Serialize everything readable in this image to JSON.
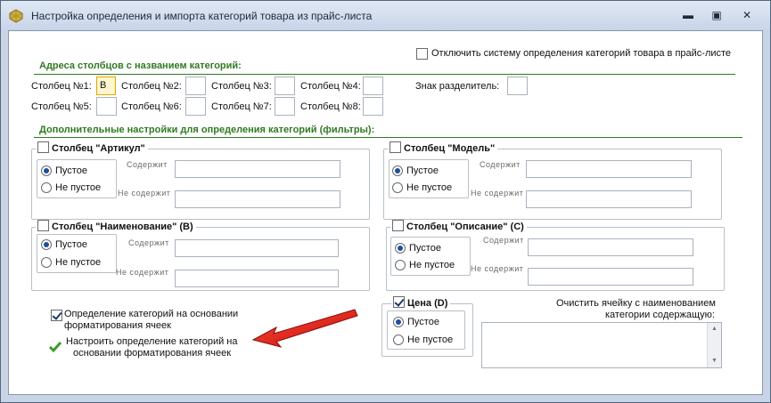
{
  "window": {
    "title": "Настройка определения и импорта категорий товара из прайс-листа",
    "minimize_glyph": "▬",
    "maximize_glyph": "▣",
    "close_glyph": "✕"
  },
  "disable_system": {
    "label": "Отключить систему определения категорий товара в прайс-листе",
    "checked": false
  },
  "columns_section": {
    "heading": "Адреса столбцов с названием категорий:",
    "col1": "Столбец №1:",
    "col1_value": "B",
    "col2": "Столбец №2:",
    "col3": "Столбец №3:",
    "col4": "Столбец №4:",
    "col5": "Столбец №5:",
    "col6": "Столбец №6:",
    "col7": "Столбец №7:",
    "col8": "Столбец №8:",
    "separator_label": "Знак разделитель:"
  },
  "filters_section": {
    "heading": "Дополнительные настройки для определения категорий (фильтры):"
  },
  "filters": {
    "article": {
      "label": "Столбец \"Артикул\""
    },
    "model": {
      "label": "Столбец \"Модель\""
    },
    "name": {
      "label": "Столбец \"Наименование\" (B)"
    },
    "description": {
      "label": "Столбец \"Описание\" (C)"
    },
    "price": {
      "label": "Цена (D)"
    },
    "empty": "Пустое",
    "not_empty": "Не пустое",
    "contains": "Содержит",
    "not_contains": "Не содержит"
  },
  "formatting": {
    "checkbox_label_line1": "Определение категорий на основании",
    "checkbox_label_line2": "форматирования ячеек",
    "link_line1": "Настроить определение категорий на",
    "link_line2": "основании форматирования ячеек"
  },
  "clear_cell": {
    "label_line1": "Очистить ячейку с наименованием",
    "label_line2": "категории содержащую:"
  },
  "colors": {
    "accent_green": "#2f7a22",
    "arrow_red": "#e01a14"
  },
  "icons": {
    "app": "app-icon",
    "check": "checkmark-icon",
    "pointer": "red-arrow"
  }
}
